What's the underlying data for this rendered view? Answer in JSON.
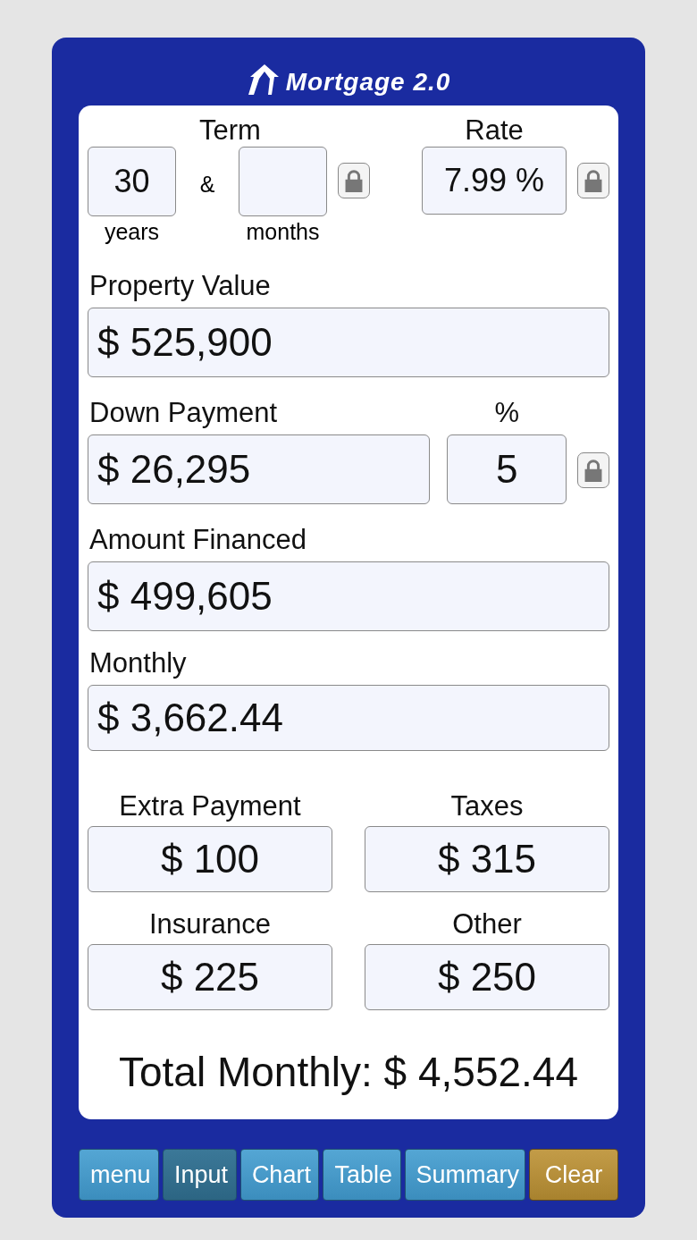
{
  "app": {
    "title": "Mortgage 2.0"
  },
  "term": {
    "label": "Term",
    "years": {
      "value": "30",
      "caption": "years"
    },
    "joiner": "&",
    "months": {
      "caption": "months"
    }
  },
  "rate": {
    "label": "Rate",
    "value": "7.99 %"
  },
  "property_value": {
    "label": "Property Value",
    "value": "$ 525,900"
  },
  "down_payment": {
    "label": "Down Payment",
    "value": "$ 26,295",
    "percent_label": "%",
    "percent": "5"
  },
  "amount_financed": {
    "label": "Amount Financed",
    "value": "$ 499,605"
  },
  "monthly": {
    "label": "Monthly",
    "value": "$ 3,662.44"
  },
  "extras": [
    {
      "label": "Extra Payment",
      "value": "$ 100"
    },
    {
      "label": "Taxes",
      "value": "$ 315"
    },
    {
      "label": "Insurance",
      "value": "$ 225"
    },
    {
      "label": "Other",
      "value": "$ 250"
    }
  ],
  "total": "Total Monthly: $ 4,552.44",
  "buttons": [
    {
      "label": "menu",
      "kind": "nav",
      "selected": false
    },
    {
      "label": "Input",
      "kind": "nav",
      "selected": true
    },
    {
      "label": "Chart",
      "kind": "nav",
      "selected": false
    },
    {
      "label": "Table",
      "kind": "nav",
      "selected": false
    },
    {
      "label": "Summary",
      "kind": "nav",
      "selected": false
    },
    {
      "label": "Clear",
      "kind": "action",
      "selected": false
    }
  ]
}
